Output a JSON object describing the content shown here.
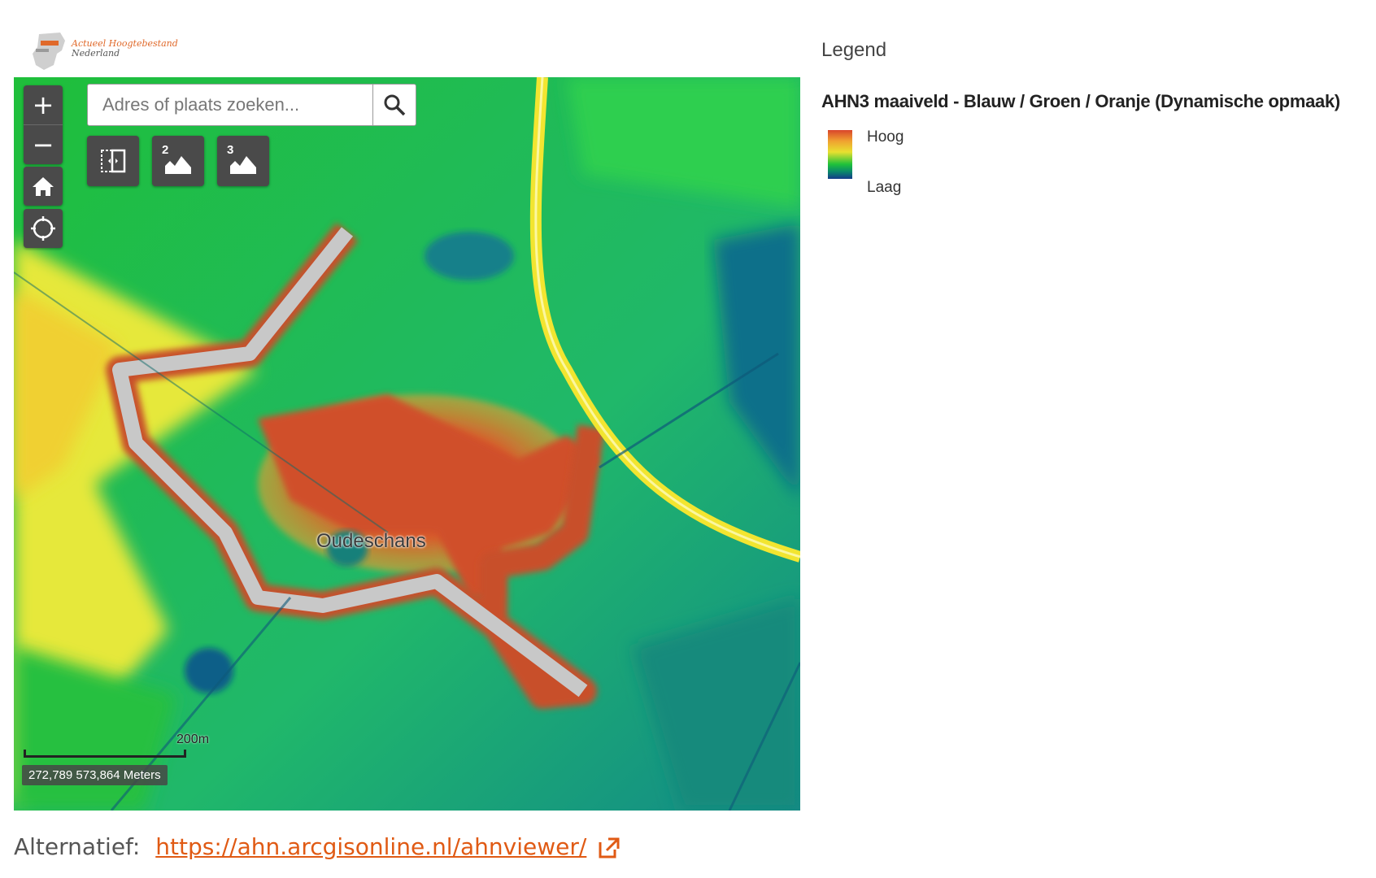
{
  "header": {
    "logo_line1": "Actueel Hoogtebestand",
    "logo_line2": "Nederland"
  },
  "map": {
    "search": {
      "placeholder": "Adres of plaats zoeken..."
    },
    "zoom_in": "+",
    "zoom_out": "−",
    "tool_compare_label": "",
    "tool_ahn2_label": "2",
    "tool_ahn3_label": "3",
    "place_label": "Oudeschans",
    "scale_label": "200m",
    "coordinates": "272,789 573,864 Meters"
  },
  "legend": {
    "title": "Legend",
    "layer_name": "AHN3 maaiveld - Blauw / Groen / Oranje (Dynamische opmaak)",
    "high_label": "Hoog",
    "low_label": "Laag",
    "ramp_colors": [
      "#d9452b",
      "#f0a030",
      "#e8e030",
      "#1fc23a",
      "#0a8a6a",
      "#123a8a"
    ]
  },
  "footer": {
    "prefix": "Alternatief:",
    "link_text": "https://ahn.arcgisonline.nl/ahnviewer/"
  }
}
